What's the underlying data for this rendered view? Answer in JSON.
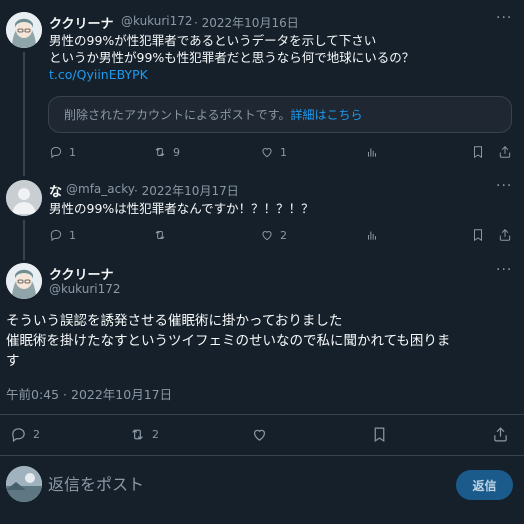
{
  "tweet1": {
    "name": "ククリーナ",
    "handle": "@kukuri172",
    "date": "· 2022年10月16日",
    "lines": [
      "男性の99%が性犯罪者であるというデータを示して下さい",
      "というか男性が99%も性犯罪者だと思うなら何で地球にいるの？",
      "t.co/QyiinEBYPK"
    ],
    "quote": {
      "text": "削除されたアカウントによるポストです。",
      "link": "詳細はこちら"
    },
    "stats": {
      "replies": "1",
      "reposts": "9",
      "likes": "1"
    }
  },
  "tweet2": {
    "name": "な",
    "handle": "@mfa_acky",
    "date": "· 2022年10月17日",
    "text": "男性の99%は性犯罪者なんですか！？！？！？",
    "stats": {
      "replies": "1",
      "reposts": "",
      "likes": "2"
    }
  },
  "main_tweet": {
    "name": "ククリーナ",
    "handle": "@kukuri172",
    "lines": [
      "そういう誤認を誘発させる催眠術に掛かっておりました",
      "催眠術を掛けたなすというツイフェミのせいなので私に聞かれても困りま",
      "す"
    ],
    "timestamp": "午前0:45 · 2022年10月17日",
    "stats": {
      "replies": "2",
      "reposts": "2"
    }
  },
  "composer": {
    "placeholder": "返信をポスト",
    "button": "返信"
  },
  "more_symbol": "···",
  "colors": {
    "background": "#15202b",
    "accent": "#1d9bf0",
    "muted": "#8b98a5",
    "border": "#38444d"
  }
}
